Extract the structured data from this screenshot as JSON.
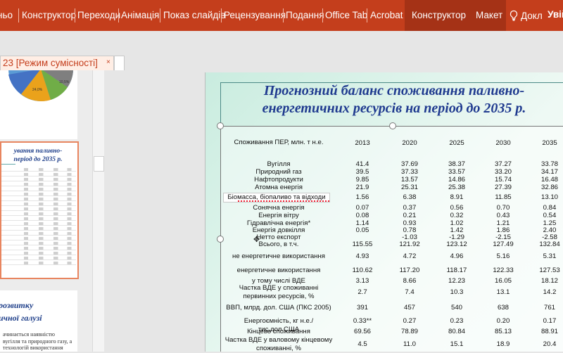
{
  "ribbon": {
    "tabs": [
      "ньо",
      "Конструктор",
      "Переходи",
      "Анімація",
      "Показ слайдів",
      "Рецензування",
      "Подання",
      "Office Tab",
      "Acrobat"
    ],
    "context_tabs": [
      "Конструктор",
      "Макет"
    ],
    "tell_me": "Докл",
    "user": "Увійт",
    "colors": {
      "ribbon": "#c43e1c",
      "context": "#a53216"
    }
  },
  "document_tab": {
    "title": "23 [Режим сумісності]",
    "close": "×"
  },
  "thumbnails": {
    "thumb1": {
      "pie_labels": [
        "24,0%",
        "10,5%"
      ]
    },
    "thumb2": {
      "title_line1": "ування паливно-",
      "title_line2": "період до 2035 р."
    },
    "thumb3": {
      "title_line1": "розвитку",
      "title_line2": "ичної галузі",
      "text": [
        "ачинається наявністю",
        "вугілля та природного газу, а",
        "технологій використання"
      ]
    }
  },
  "slide": {
    "title_line1": "Прогнозний баланс споживання паливно-",
    "title_line2": "енергетичних ресурсів на період до 2035 р.",
    "table": {
      "header": {
        "label": "Споживання ПЕР, млн. т н.е.",
        "years": [
          "2013",
          "2020",
          "2025",
          "2030",
          "2035"
        ]
      },
      "rows": [
        {
          "label": "Вугілля",
          "values": [
            "41.4",
            "37.69",
            "38.37",
            "37.27",
            "33.78"
          ]
        },
        {
          "label": "Природний газ",
          "values": [
            "39.5",
            "37.33",
            "33.57",
            "33.20",
            "34.17"
          ]
        },
        {
          "label": "Нафтопродукти",
          "values": [
            "9.85",
            "13.57",
            "14.86",
            "15.74",
            "16.48"
          ]
        },
        {
          "label": "Атомна енергія",
          "values": [
            "21.9",
            "25.31",
            "25.38",
            "27.39",
            "32.86"
          ]
        },
        {
          "label": "Біомасса, біопаливо та відходи",
          "values": [
            "1.56",
            "6.38",
            "8.91",
            "11.85",
            "13.10"
          ]
        },
        {
          "label": "Сонячна енергія",
          "values": [
            "0.07",
            "0.37",
            "0.56",
            "0.70",
            "0.84"
          ]
        },
        {
          "label": "Енергія вітру",
          "values": [
            "0.08",
            "0.21",
            "0.32",
            "0.43",
            "0.54"
          ]
        },
        {
          "label": "Гідравлічна енергія*",
          "values": [
            "1.14",
            "0.93",
            "1.02",
            "1.21",
            "1.25"
          ]
        },
        {
          "label": "Енергія довкілля",
          "values": [
            "0.05",
            "0.78",
            "1.42",
            "1.86",
            "2.40"
          ]
        },
        {
          "label": "Нетто експорт",
          "values": [
            "",
            "-1.03",
            "-1.29",
            "-2.15",
            "-2.58"
          ]
        },
        {
          "label": "Всього, в т.ч.",
          "values": [
            "115.55",
            "121.92",
            "123.12",
            "127.49",
            "132.84"
          ]
        },
        {
          "label": "не енергетичне використання",
          "values": [
            "4.93",
            "4.72",
            "4.96",
            "5.16",
            "5.31"
          ]
        },
        {
          "label": "енергетичне використання",
          "values": [
            "110.62",
            "117.20",
            "118.17",
            "122.33",
            "127.53"
          ]
        },
        {
          "label": "у тому числі ВДЕ",
          "values": [
            "3.13",
            "8.66",
            "12.23",
            "16.05",
            "18.12"
          ]
        },
        {
          "label": "Частка ВДЕ у споживанні первинних ресурсів, %",
          "values": [
            "2.7",
            "7.4",
            "10.3",
            "13.1",
            "14.2"
          ]
        },
        {
          "label": "ВВП, млрд. дол. США (ПКС 2005)",
          "values": [
            "391",
            "457",
            "540",
            "638",
            "761"
          ]
        },
        {
          "label": "Енергоємність, кг н.е./тис.дол.США",
          "values": [
            "0.33**",
            "0.27",
            "0.23",
            "0.20",
            "0.17"
          ]
        },
        {
          "label": "Кінцеве споживання",
          "values": [
            "69.56",
            "78.89",
            "80.84",
            "85.13",
            "88.91"
          ]
        },
        {
          "label": "Частка ВДЕ у валовому кінцевому споживанні, %",
          "values": [
            "4.5",
            "11.0",
            "15.1",
            "18.9",
            "20.4"
          ]
        }
      ]
    }
  }
}
